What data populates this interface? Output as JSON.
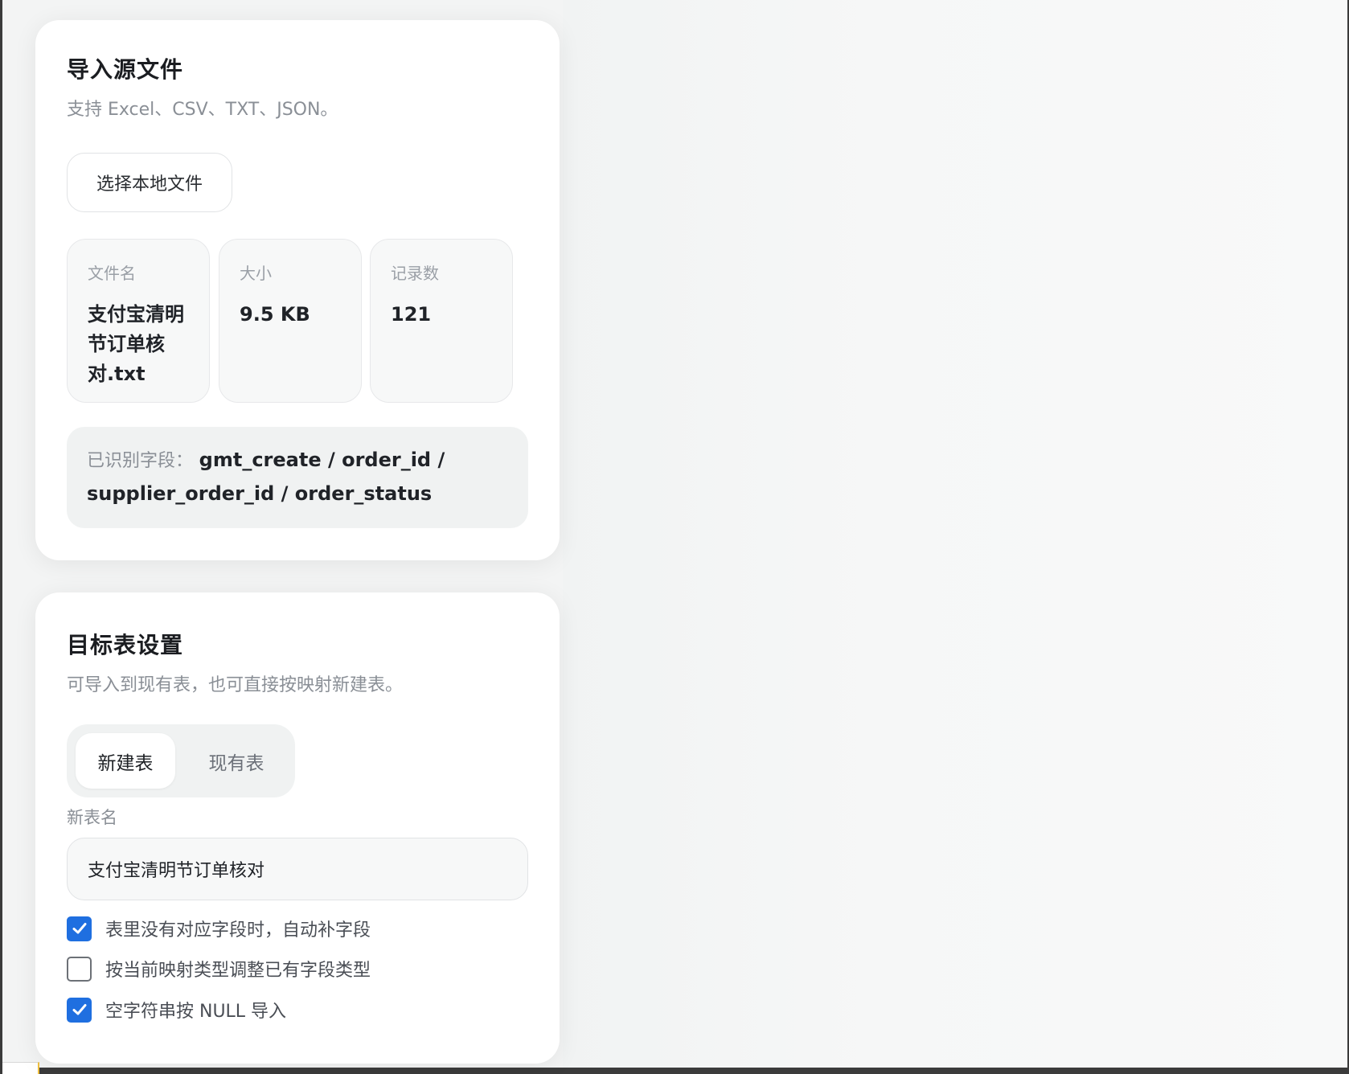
{
  "source_card": {
    "title": "导入源文件",
    "subtitle": "支持 Excel、CSV、TXT、JSON。",
    "pick_button": "选择本地文件",
    "stats": [
      {
        "label": "文件名",
        "value": "支付宝清明节订单核对.txt"
      },
      {
        "label": "大小",
        "value": "9.5 KB"
      },
      {
        "label": "记录数",
        "value": "121"
      }
    ],
    "fields_label": "已识别字段：",
    "fields_value": "gmt_create / order_id / supplier_order_id / order_status"
  },
  "target_card": {
    "title": "目标表设置",
    "subtitle": "可导入到现有表，也可直接按映射新建表。",
    "segments": [
      {
        "label": "新建表",
        "active": true
      },
      {
        "label": "现有表",
        "active": false
      }
    ],
    "table_name_label": "新表名",
    "table_name_value": "支付宝清明节订单核对",
    "options": [
      {
        "label": "表里没有对应字段时，自动补字段",
        "checked": true
      },
      {
        "label": "按当前映射类型调整已有字段类型",
        "checked": false
      },
      {
        "label": "空字符串按 NULL 导入",
        "checked": true
      }
    ]
  },
  "colors": {
    "accent": "#1f6fe0",
    "card_bg": "#ffffff",
    "page_bg": "#f3f4f4"
  },
  "icons": {
    "checkbox_checked": "check-icon"
  }
}
